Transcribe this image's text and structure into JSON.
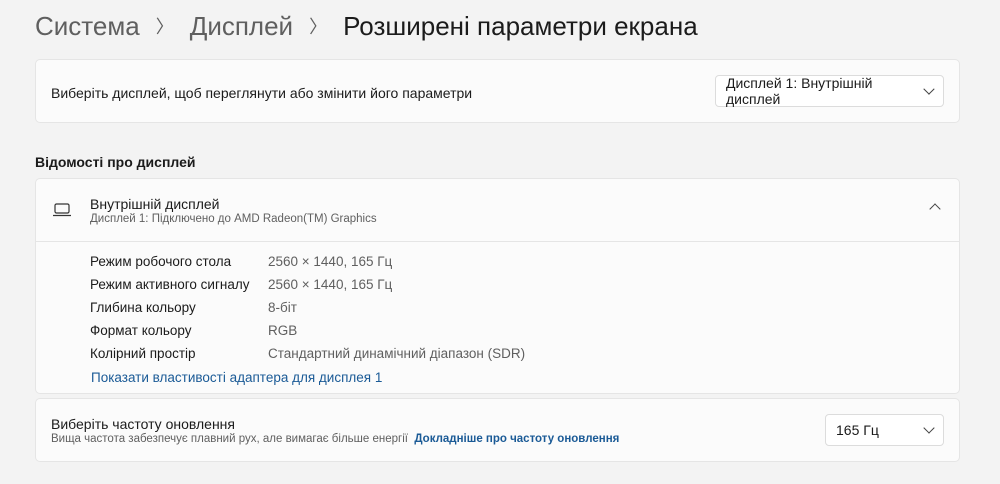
{
  "breadcrumb": [
    "Система",
    "Дисплей",
    "Розширені параметри екрана"
  ],
  "select_display": {
    "label": "Виберіть дисплей, щоб переглянути або змінити його параметри",
    "value": "Дисплей 1: Внутрішній дисплей"
  },
  "section_title": "Відомості про дисплей",
  "display_info": {
    "title": "Внутрішній дисплей",
    "subtitle": "Дисплей 1: Підключено до AMD Radeon(TM) Graphics",
    "rows": [
      {
        "k": "Режим робочого стола",
        "v": "2560 × 1440, 165 Гц"
      },
      {
        "k": "Режим активного сигналу",
        "v": "2560 × 1440, 165 Гц"
      },
      {
        "k": "Глибина кольору",
        "v": "8-біт"
      },
      {
        "k": "Формат кольору",
        "v": "RGB"
      },
      {
        "k": "Колірний простір",
        "v": "Стандартний динамічний діапазон (SDR)"
      }
    ],
    "link": "Показати властивості адаптера для дисплея 1"
  },
  "refresh": {
    "title": "Виберіть частоту оновлення",
    "desc": "Вища частота забезпечує плавний рух, але вимагає більше енергії",
    "link": "Докладніше про частоту оновлення",
    "value": "165 Гц"
  }
}
